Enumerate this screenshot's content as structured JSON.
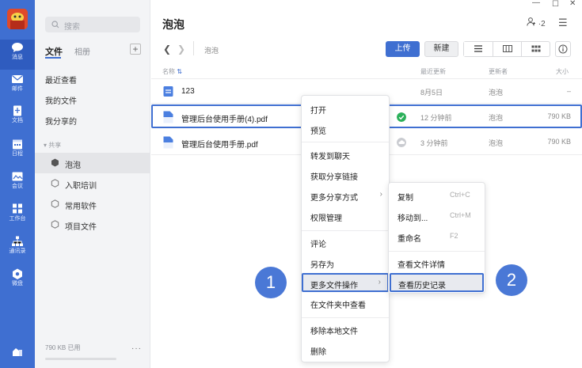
{
  "rail": {
    "items": [
      {
        "label": "消息"
      },
      {
        "label": "邮件"
      },
      {
        "label": "文档"
      },
      {
        "label": "日程"
      },
      {
        "label": "会议"
      },
      {
        "label": "工作台"
      },
      {
        "label": "通讯录"
      },
      {
        "label": "微盘"
      }
    ],
    "accent": "#3f6fd1"
  },
  "sidebar": {
    "search_placeholder": "搜索",
    "tabs": [
      {
        "label": "文件"
      },
      {
        "label": "相册"
      }
    ],
    "add_label": "+",
    "links": [
      {
        "label": "最近查看"
      },
      {
        "label": "我的文件"
      },
      {
        "label": "我分享的"
      }
    ],
    "group_label": "共享",
    "spaces": [
      {
        "label": "泡泡",
        "icon": "cube-icon"
      },
      {
        "label": "入职培训",
        "icon": "cube-outline-icon"
      },
      {
        "label": "常用软件",
        "icon": "cube-outline-icon"
      },
      {
        "label": "项目文件",
        "icon": "cube-outline-icon"
      }
    ],
    "storage": "790 KB 已用",
    "more": "···"
  },
  "header": {
    "title": "泡泡",
    "member_count": "·2",
    "breadcrumb": "泡泡",
    "upload_label": "上传",
    "new_label": "新建",
    "info_label": "i"
  },
  "columns": {
    "name": "名称",
    "modified": "最近更新",
    "owner": "更新者",
    "size": "大小"
  },
  "files": [
    {
      "name": "123",
      "modified": "8月5日",
      "owner": "泡泡",
      "size": "–",
      "type": "folder"
    },
    {
      "name": "管理后台使用手册(4).pdf",
      "modified": "12 分钟前",
      "owner": "泡泡",
      "size": "790 KB",
      "type": "doc",
      "status": "synced"
    },
    {
      "name": "管理后台使用手册.pdf",
      "modified": "3 分钟前",
      "owner": "泡泡",
      "size": "790 KB",
      "type": "doc",
      "status": "cloud"
    }
  ],
  "context_menu": {
    "items": [
      "打开",
      "预览",
      "转发到聊天",
      "获取分享链接",
      "更多分享方式",
      "权限管理",
      "评论",
      "另存为",
      "更多文件操作",
      "在文件夹中查看",
      "移除本地文件",
      "删除"
    ]
  },
  "submenu": {
    "items": [
      {
        "label": "复制",
        "shortcut": "Ctrl+C"
      },
      {
        "label": "移动到...",
        "shortcut": "Ctrl+M"
      },
      {
        "label": "重命名",
        "shortcut": "F2"
      },
      {
        "label": "查看文件详情",
        "shortcut": ""
      },
      {
        "label": "查看历史记录",
        "shortcut": ""
      }
    ]
  },
  "callouts": [
    "1",
    "2"
  ]
}
